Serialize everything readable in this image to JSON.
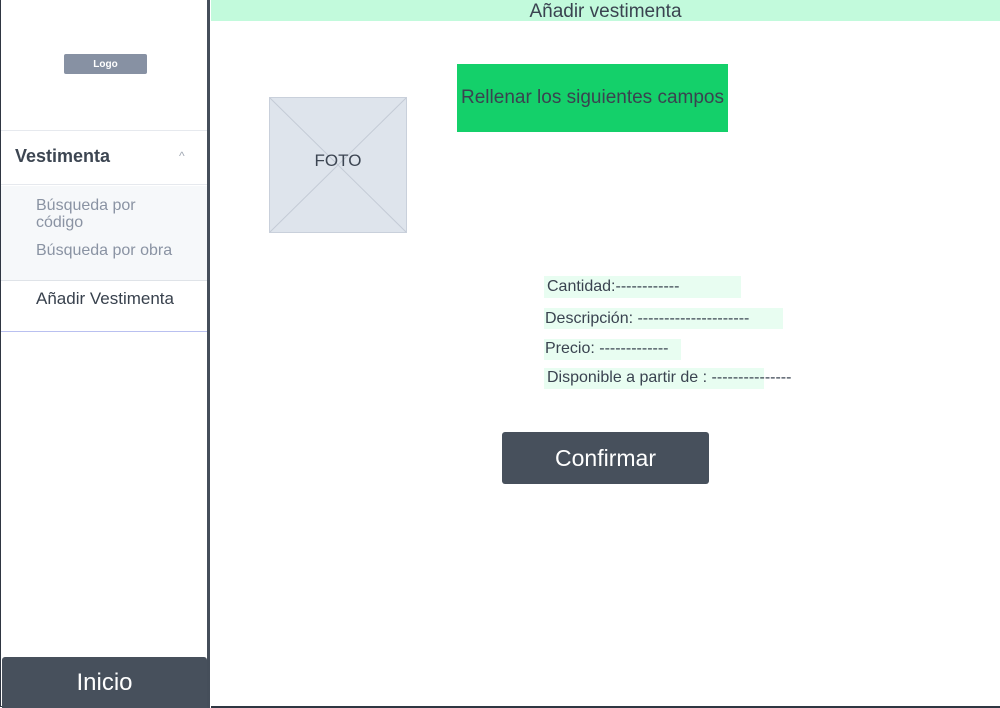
{
  "sidebar": {
    "logo_label": "Logo",
    "section_title": "Vestimenta",
    "section_chevron": "^",
    "subnav": [
      {
        "label": "Búsqueda por código"
      },
      {
        "label": "Búsqueda por obra"
      }
    ],
    "active_item": "Añadir Vestimenta",
    "home_button": "Inicio"
  },
  "header": {
    "title": "Añadir vestimenta"
  },
  "main": {
    "photo_label": "FOTO",
    "banner": "Rellenar los siguientes campos",
    "fields": [
      {
        "label": "Cantidad:------------"
      },
      {
        "label": "Descripción: ---------------------"
      },
      {
        "label": "Precio: -------------"
      },
      {
        "label": "Disponible a partir de : ---------------"
      }
    ],
    "confirm_button": "Confirmar"
  },
  "colors": {
    "header_bg": "#c2fadc",
    "banner_bg": "#14d06a",
    "field_bg": "#e8fdf1",
    "button_bg": "#47505c"
  }
}
